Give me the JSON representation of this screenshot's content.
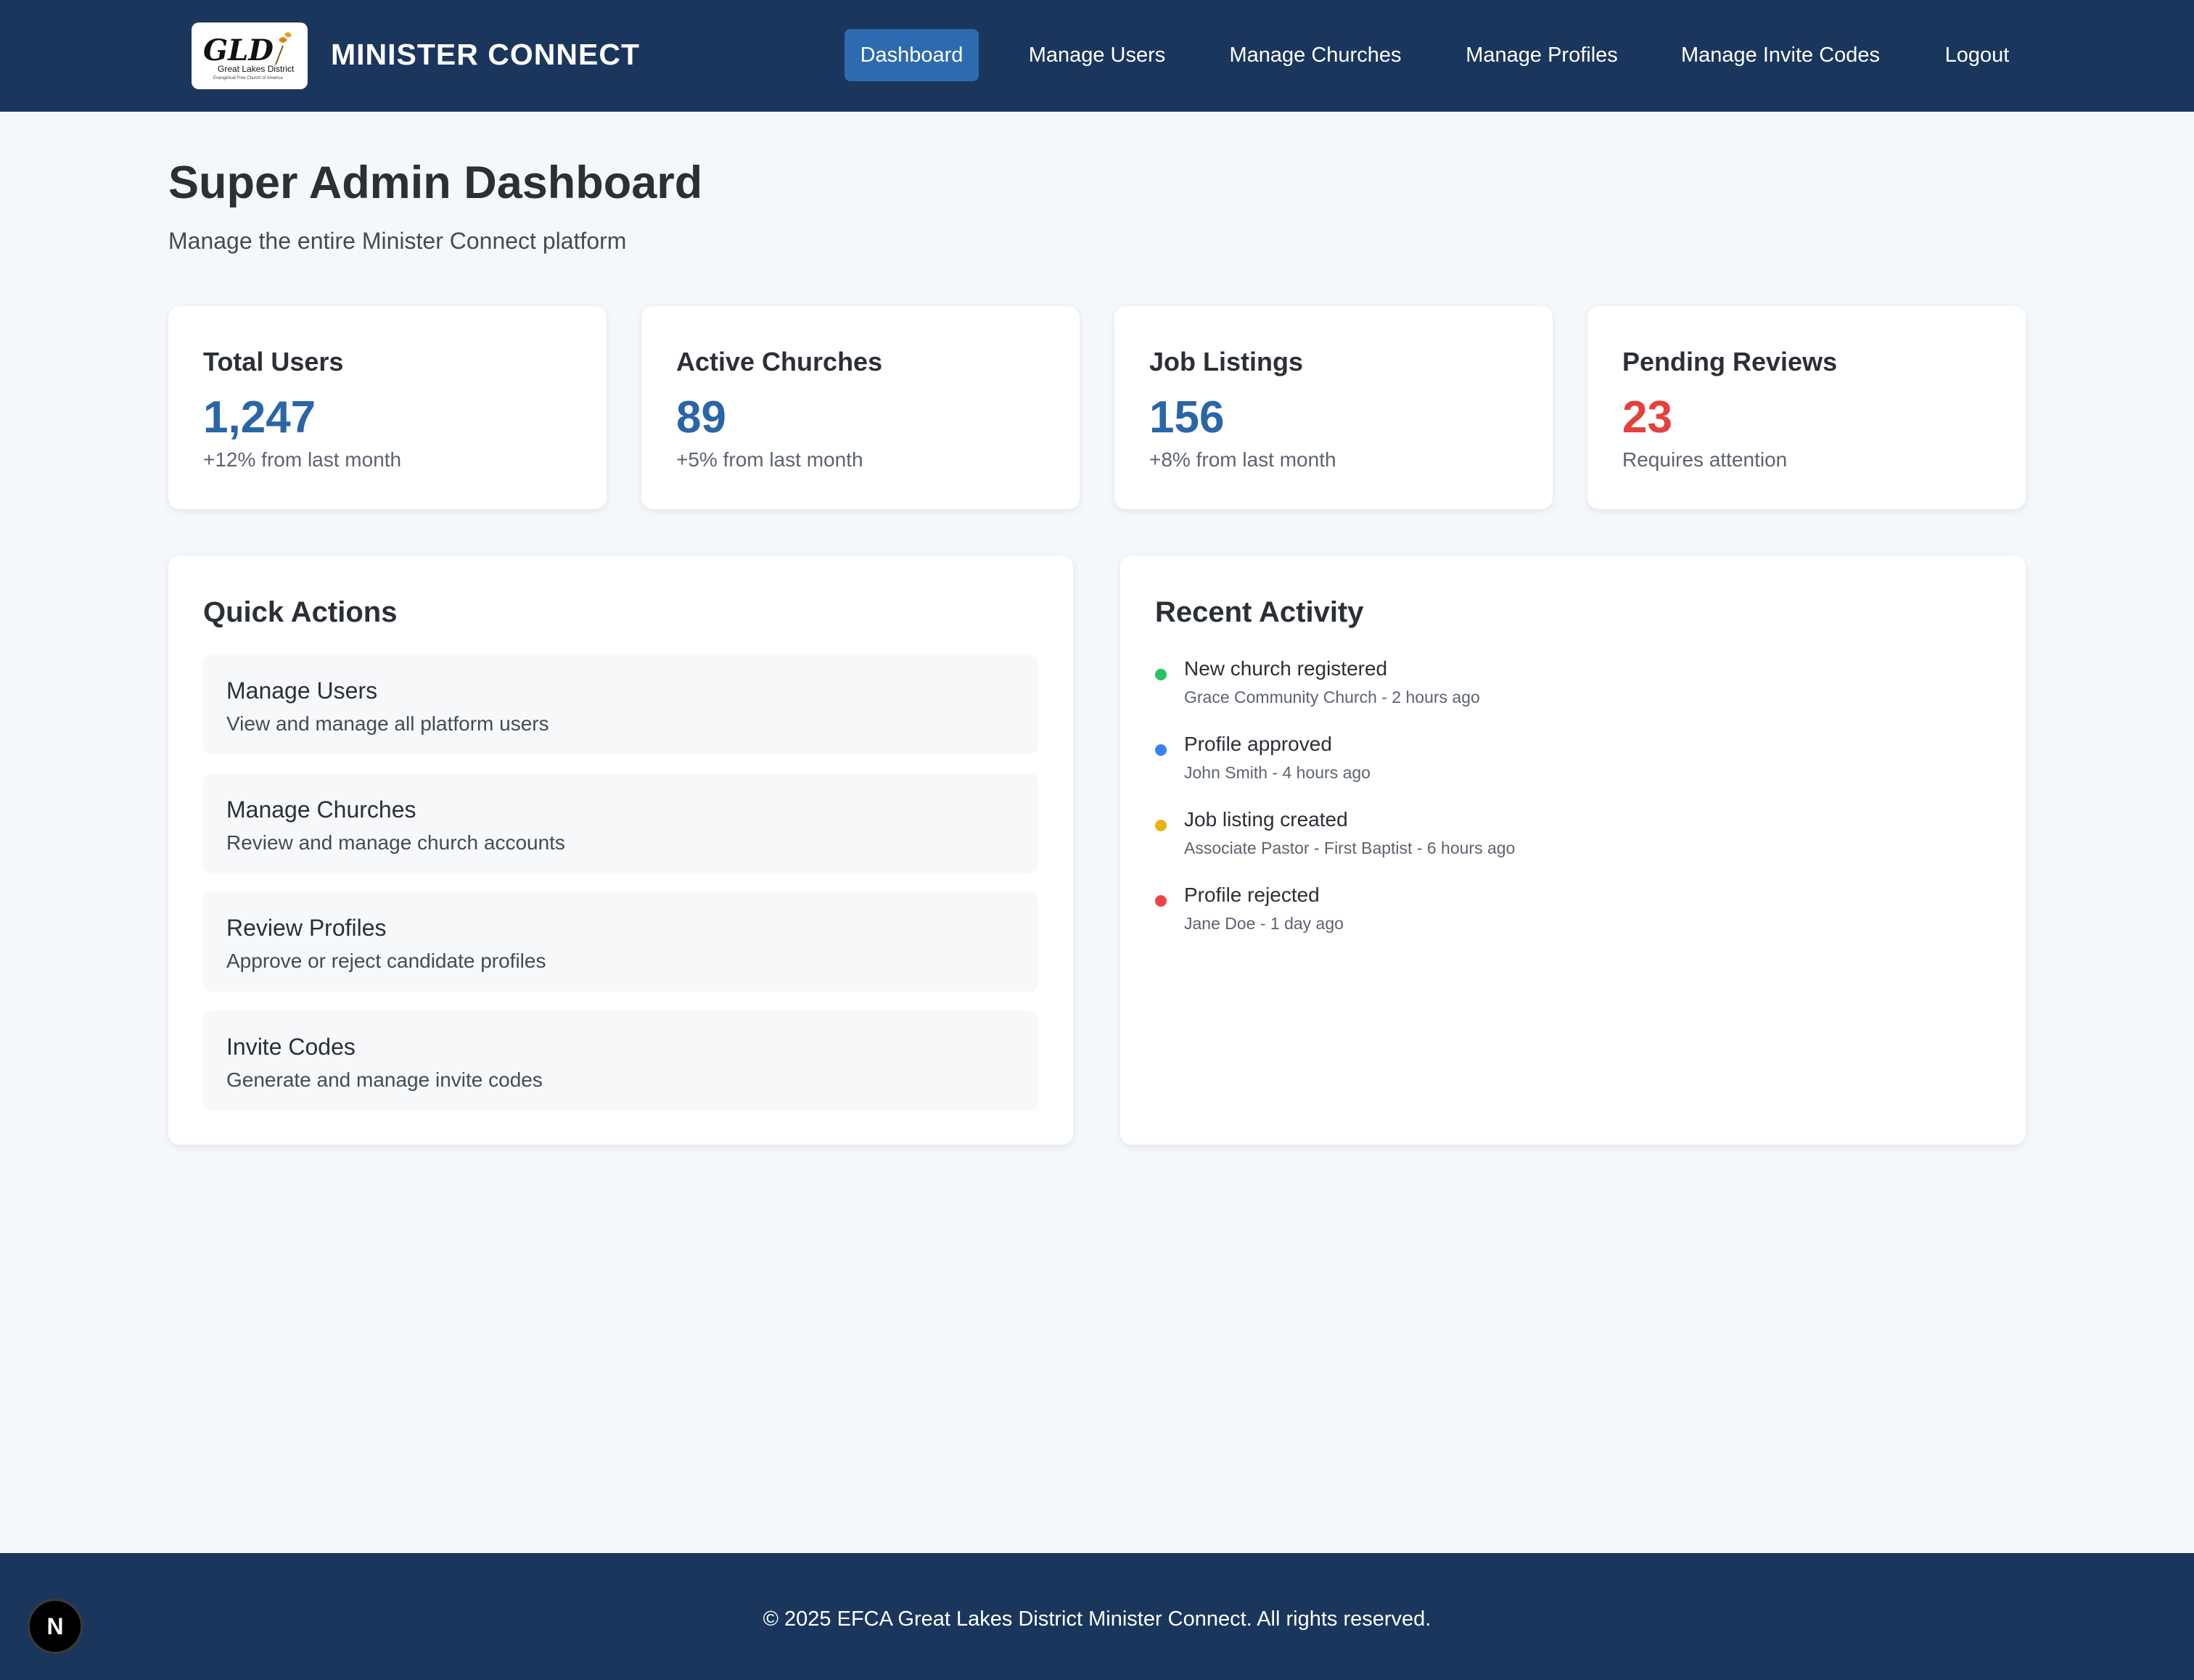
{
  "header": {
    "brand": "MINISTER CONNECT",
    "logo": {
      "monogram": "GLD",
      "name": "Great Lakes District",
      "tagline": "Evangelical Free Church of America"
    },
    "nav": [
      {
        "label": "Dashboard",
        "active": true
      },
      {
        "label": "Manage Users"
      },
      {
        "label": "Manage Churches"
      },
      {
        "label": "Manage Profiles"
      },
      {
        "label": "Manage Invite Codes"
      },
      {
        "label": "Logout"
      }
    ]
  },
  "page": {
    "title": "Super Admin Dashboard",
    "subtitle": "Manage the entire Minister Connect platform"
  },
  "stats": [
    {
      "title": "Total Users",
      "value": "1,247",
      "note": "+12% from last month"
    },
    {
      "title": "Active Churches",
      "value": "89",
      "note": "+5% from last month"
    },
    {
      "title": "Job Listings",
      "value": "156",
      "note": "+8% from last month"
    },
    {
      "title": "Pending Reviews",
      "value": "23",
      "note": "Requires attention"
    }
  ],
  "quick_actions": {
    "title": "Quick Actions",
    "items": [
      {
        "label": "Manage Users",
        "desc": "View and manage all platform users"
      },
      {
        "label": "Manage Churches",
        "desc": "Review and manage church accounts"
      },
      {
        "label": "Review Profiles",
        "desc": "Approve or reject candidate profiles"
      },
      {
        "label": "Invite Codes",
        "desc": "Generate and manage invite codes"
      }
    ]
  },
  "recent_activity": {
    "title": "Recent Activity",
    "items": [
      {
        "title": "New church registered",
        "meta": "Grace Community Church - 2 hours ago",
        "color": "#22c55e"
      },
      {
        "title": "Profile approved",
        "meta": "John Smith - 4 hours ago",
        "color": "#3b82f6"
      },
      {
        "title": "Job listing created",
        "meta": "Associate Pastor - First Baptist - 6 hours ago",
        "color": "#eab308"
      },
      {
        "title": "Profile rejected",
        "meta": "Jane Doe - 1 day ago",
        "color": "#ef4444"
      }
    ]
  },
  "colors": {
    "header_bg": "#1b365d",
    "nav_active_bg": "#2d6ab0",
    "stat_value": "#2a65a8",
    "stat_alert": "#e5403b",
    "page_bg": "#f5f8fb"
  },
  "footer": {
    "text": "© 2025 EFCA Great Lakes District Minister Connect. All rights reserved."
  },
  "dev_badge": {
    "label": "N",
    "icon": "nextjs-icon"
  }
}
